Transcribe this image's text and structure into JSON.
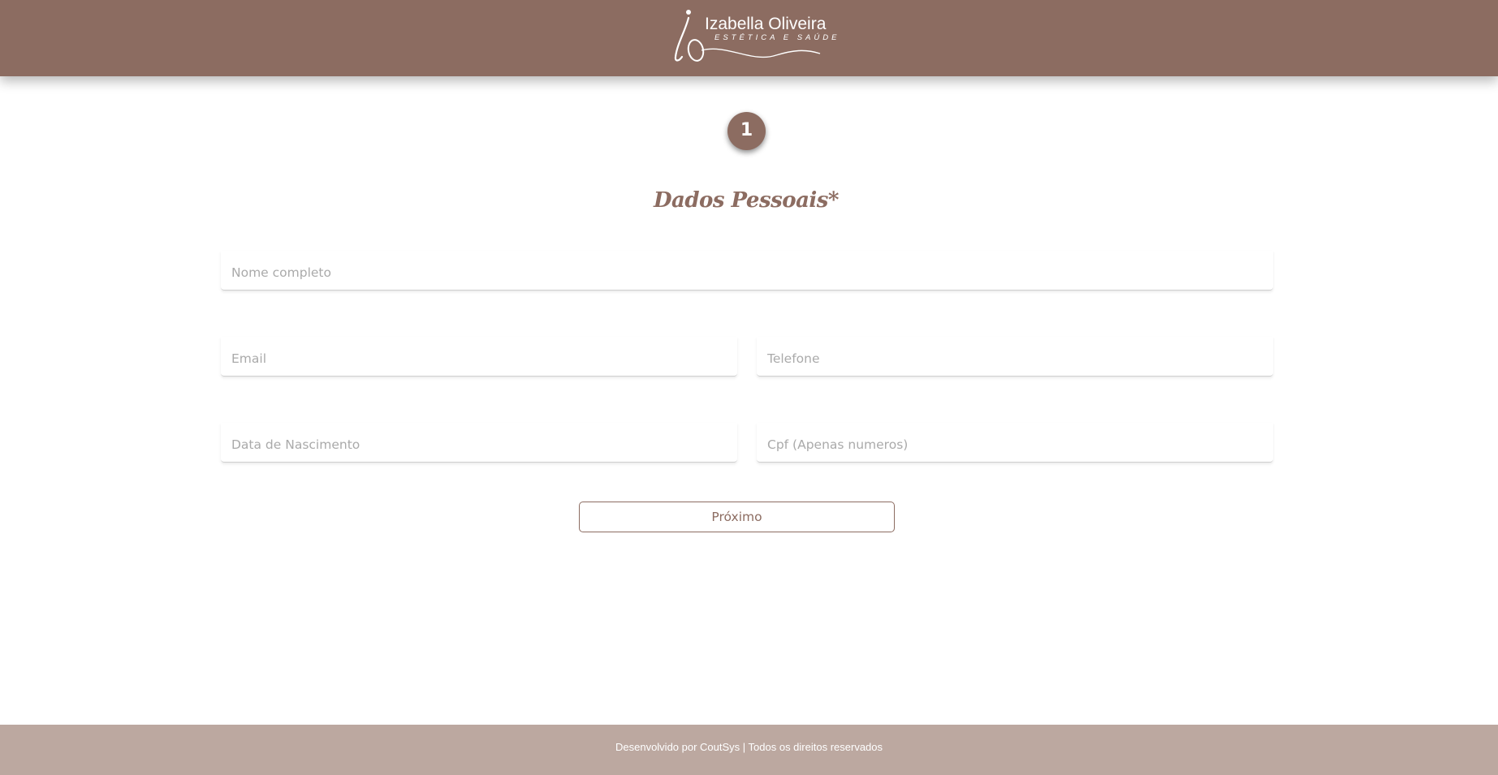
{
  "header": {
    "logo_name": "Izabella Oliveira",
    "logo_subtitle": "ESTÉTICA E SAÚDE",
    "logo_monogram": "io",
    "background_color": "#8c6c61"
  },
  "stepper": {
    "current_step": "1"
  },
  "form": {
    "section_title": "Dados Pessoais*",
    "full_name": {
      "placeholder": "Nome completo",
      "value": ""
    },
    "email": {
      "placeholder": "Email",
      "value": ""
    },
    "phone": {
      "placeholder": "Telefone",
      "value": ""
    },
    "birth_date": {
      "placeholder": "Data de Nascimento",
      "value": ""
    },
    "cpf": {
      "placeholder": "Cpf (Apenas numeros)",
      "value": ""
    },
    "next_label": "Próximo"
  },
  "footer": {
    "text": "Desenvolvido por CoutSys | Todos os direitos reservados",
    "background_color": "#bca8a0"
  }
}
